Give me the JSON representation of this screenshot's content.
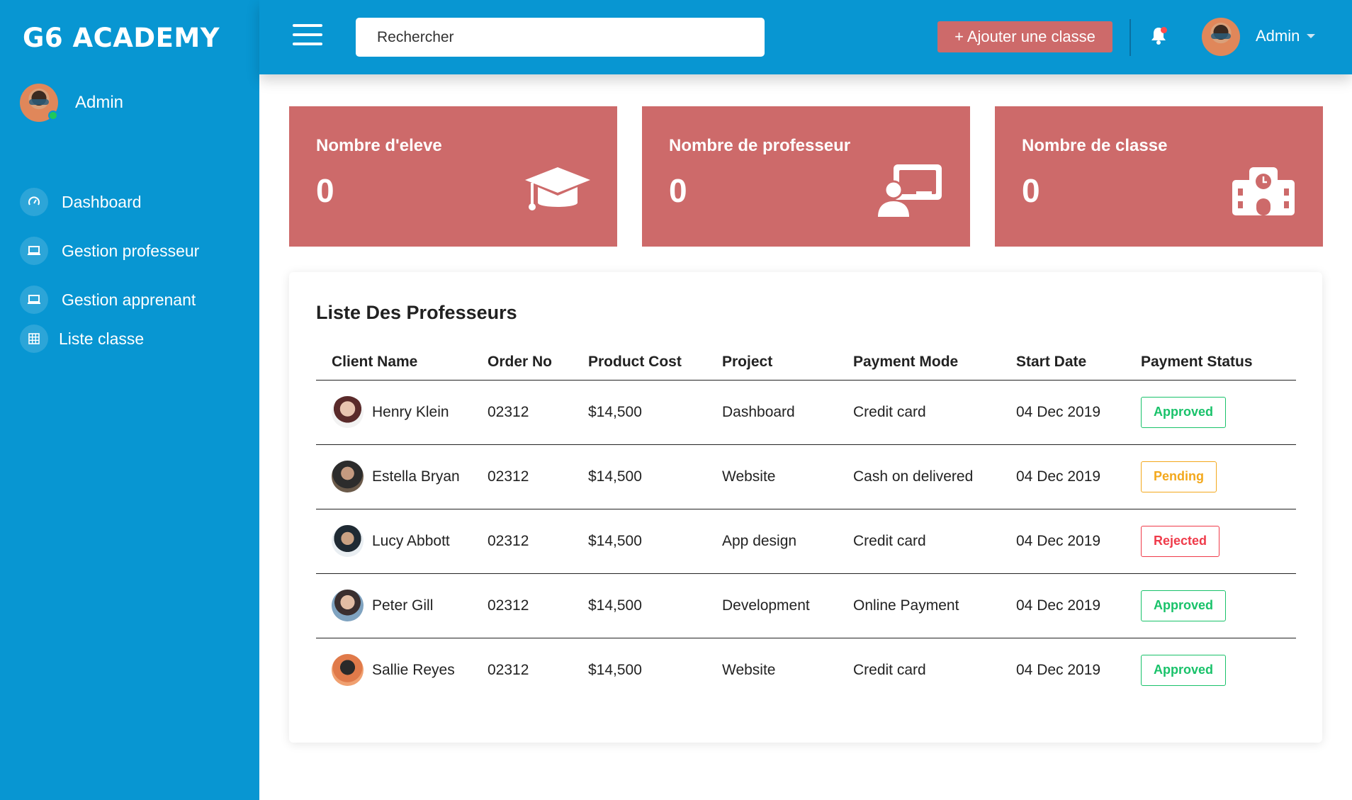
{
  "sidebar": {
    "brand": "G6 ACADEMY",
    "user_name": "Admin",
    "items": [
      {
        "label": "Dashboard",
        "icon": "gauge-icon"
      },
      {
        "label": "Gestion professeur",
        "icon": "laptop-icon"
      },
      {
        "label": "Gestion apprenant",
        "icon": "laptop-icon"
      },
      {
        "label": "Liste classe",
        "icon": "grid-icon"
      }
    ]
  },
  "topbar": {
    "search_placeholder": "Rechercher",
    "add_class_label": "+ Ajouter une classe",
    "admin_label": "Admin"
  },
  "stats": [
    {
      "title": "Nombre d'eleve",
      "value": "0",
      "icon": "graduation-cap-icon"
    },
    {
      "title": "Nombre de professeur",
      "value": "0",
      "icon": "teacher-board-icon"
    },
    {
      "title": "Nombre de classe",
      "value": "0",
      "icon": "school-icon"
    }
  ],
  "table": {
    "title": "Liste Des Professeurs",
    "headers": [
      "Client Name",
      "Order No",
      "Product Cost",
      "Project",
      "Payment Mode",
      "Start Date",
      "Payment Status"
    ],
    "rows": [
      {
        "name": "Henry Klein",
        "order": "02312",
        "cost": "$14,500",
        "project": "Dashboard",
        "mode": "Credit card",
        "date": "04 Dec 2019",
        "status": "Approved"
      },
      {
        "name": "Estella Bryan",
        "order": "02312",
        "cost": "$14,500",
        "project": "Website",
        "mode": "Cash on delivered",
        "date": "04 Dec 2019",
        "status": "Pending"
      },
      {
        "name": "Lucy Abbott",
        "order": "02312",
        "cost": "$14,500",
        "project": "App design",
        "mode": "Credit card",
        "date": "04 Dec 2019",
        "status": "Rejected"
      },
      {
        "name": "Peter Gill",
        "order": "02312",
        "cost": "$14,500",
        "project": "Development",
        "mode": "Online Payment",
        "date": "04 Dec 2019",
        "status": "Approved"
      },
      {
        "name": "Sallie Reyes",
        "order": "02312",
        "cost": "$14,500",
        "project": "Website",
        "mode": "Credit card",
        "date": "04 Dec 2019",
        "status": "Approved"
      }
    ]
  },
  "colors": {
    "primary": "#0896d2",
    "card": "#cd6a6a",
    "approved": "#19c26a",
    "pending": "#f3a81c",
    "rejected": "#ef3b4a"
  }
}
